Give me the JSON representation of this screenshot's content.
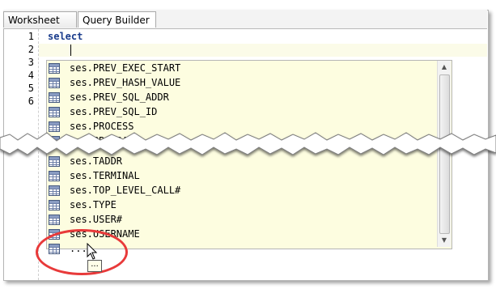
{
  "tabs": [
    {
      "label": "Worksheet",
      "active": true
    },
    {
      "label": "Query Builder",
      "active": false
    }
  ],
  "editor": {
    "line_numbers": [
      "1",
      "2",
      "3",
      "4",
      "5",
      "6"
    ],
    "code_line_1": "select"
  },
  "autocomplete": {
    "items": [
      "ses.PREV_EXEC_START",
      "ses.PREV_HASH_VALUE",
      "ses.PREV_SQL_ADDR",
      "ses.PREV_SQL_ID",
      "ses.PROCESS",
      "ses.PROGRAM",
      "ses.TADDR",
      "ses.TERMINAL",
      "ses.TOP_LEVEL_CALL#",
      "ses.TYPE",
      "ses.USER#",
      "ses.USERNAME",
      "..."
    ],
    "icon": "table-column-icon"
  },
  "tooltip": "...",
  "colors": {
    "highlight": "#e83a3a",
    "popup_bg": "#fdfde0",
    "keyword": "#1a3c8c"
  }
}
